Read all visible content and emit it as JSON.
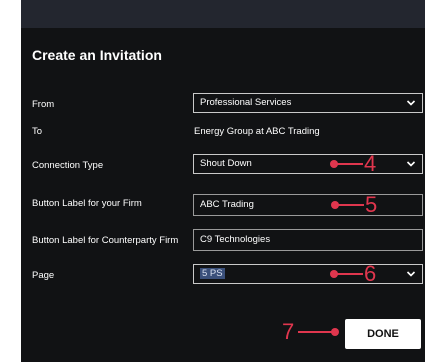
{
  "dialog": {
    "title": "Create an Invitation",
    "labels": {
      "from": "From",
      "to": "To",
      "connection_type": "Connection Type",
      "firm_label": "Button Label for your Firm",
      "counterparty_label": "Button Label for Counterparty Firm",
      "page": "Page"
    },
    "from_value": "Professional Services",
    "to_value": "Energy Group at ABC Trading",
    "connection_type_value": "Shout Down",
    "firm_label_value": "ABC Trading",
    "counterparty_label_value": "C9 Technologies",
    "page_value": "5 PS",
    "done_label": "DONE"
  },
  "annotations": {
    "step4": "4",
    "step5": "5",
    "step6": "6",
    "step7": "7"
  },
  "colors": {
    "background": "#111214",
    "topbar": "#23262f",
    "annotation": "#e0364e",
    "button": "#ffffff"
  },
  "icons": {
    "dropdown": "chevron-down-icon"
  }
}
